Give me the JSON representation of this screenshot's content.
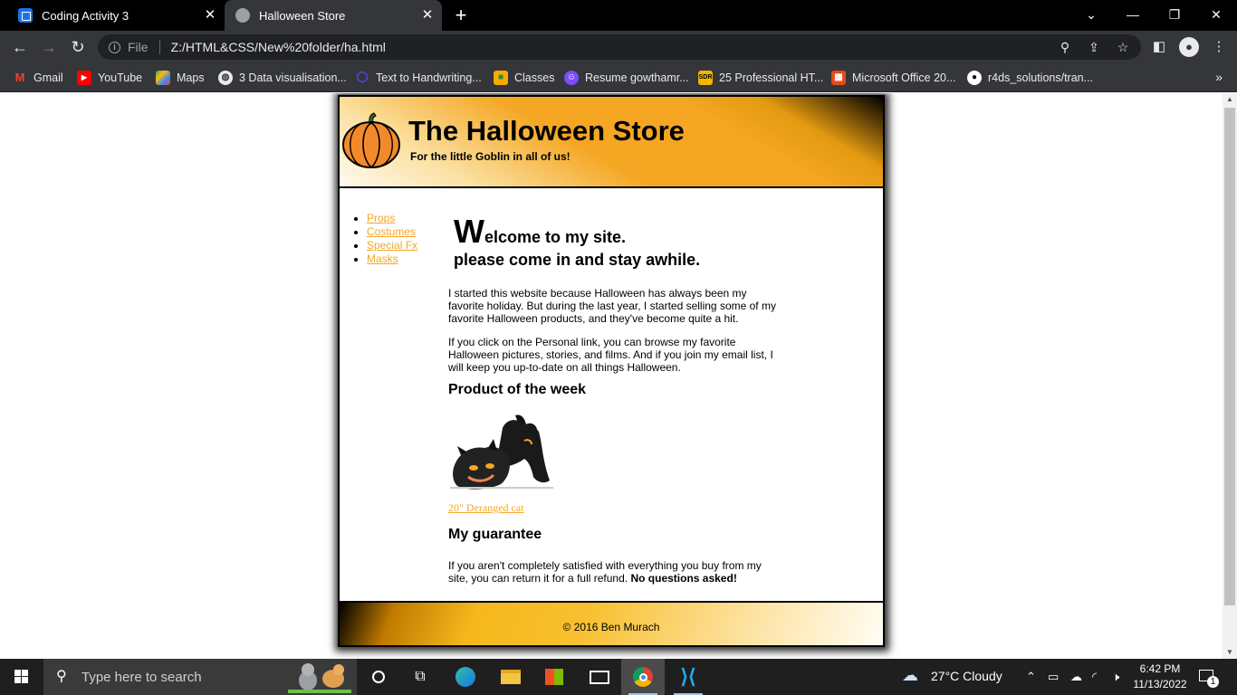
{
  "browser": {
    "tabs": [
      {
        "title": "Coding Activity 3",
        "active": false
      },
      {
        "title": "Halloween Store",
        "active": true
      }
    ],
    "address": {
      "chip": "File",
      "url": "Z:/HTML&CSS/New%20folder/ha.html"
    },
    "bookmarks": [
      {
        "label": "Gmail",
        "icon": "gmail-icon",
        "color": "#ea4335"
      },
      {
        "label": "YouTube",
        "icon": "youtube-icon",
        "color": "#ff0000"
      },
      {
        "label": "Maps",
        "icon": "maps-icon",
        "color": "#34a853"
      },
      {
        "label": "3 Data visualisation...",
        "icon": "globe-icon",
        "color": "#e8eaed"
      },
      {
        "label": "Text to Handwriting...",
        "icon": "hexagon-icon",
        "color": "#4f46e5"
      },
      {
        "label": "Classes",
        "icon": "classroom-icon",
        "color": "#f9ab00"
      },
      {
        "label": "Resume gowthamr...",
        "icon": "resume-icon",
        "color": "#7c4dff"
      },
      {
        "label": "25 Professional HT...",
        "icon": "sdr-icon",
        "color": "#f4b400"
      },
      {
        "label": "Microsoft Office 20...",
        "icon": "office-icon",
        "color": "#e64a19"
      },
      {
        "label": "r4ds_solutions/tran...",
        "icon": "github-icon",
        "color": "#ffffff"
      }
    ]
  },
  "site": {
    "title": "The Halloween Store",
    "tagline": "For the little Goblin in all of us!",
    "nav": [
      "Props",
      "Costumes",
      "Special Fx",
      "Masks"
    ],
    "welcome": {
      "cap": "W",
      "line1_rest": "elcome to my site.",
      "line2": "please come in and stay awhile."
    },
    "intro1": "I started this website because Halloween has always been my favorite holiday. But during the last year, I started selling some of my favorite Halloween products, and they've become quite a hit.",
    "intro2": "If you click on the Personal link, you can browse my favorite Halloween pictures, stories, and films. And if you join my email list, I will keep you up-to-date on all things Halloween.",
    "product_heading": "Product of the week",
    "product_link": "20\" Deranged cat",
    "guarantee_heading": "My guarantee",
    "guarantee_text": "If you aren't completely satisfied with everything you buy from my site, you can return it for a full refund.",
    "guarantee_bold": "No questions asked!",
    "footer": "© 2016 Ben Murach"
  },
  "taskbar": {
    "search_placeholder": "Type here to search",
    "weather": "27°C  Cloudy",
    "time": "6:42 PM",
    "date": "11/13/2022",
    "notifications": "1"
  },
  "colors": {
    "link": "#f5a623",
    "accent": "#f5a623"
  }
}
